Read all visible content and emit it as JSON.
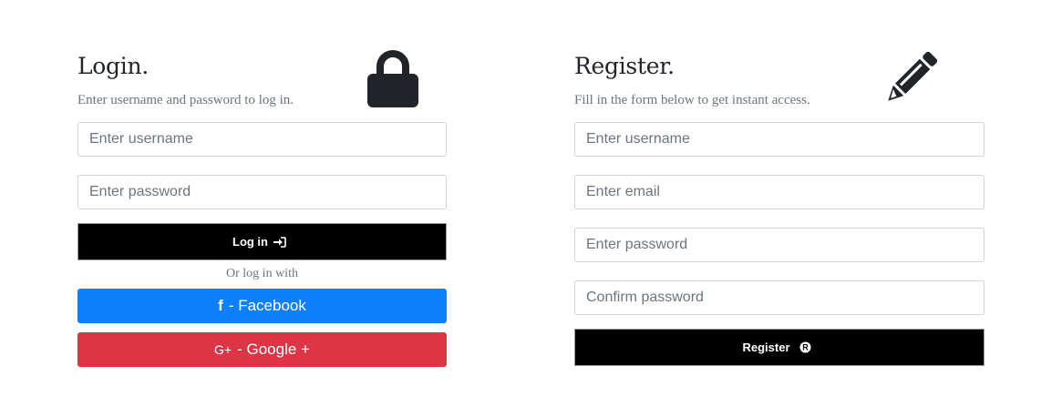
{
  "login": {
    "title": "Login.",
    "subtitle": "Enter username and password to log in.",
    "icon": "lock-icon",
    "username_placeholder": "Enter username",
    "password_placeholder": "Enter password",
    "submit_label": "Log in",
    "submit_icon": "sign-in-icon",
    "or_text": "Or log in with",
    "facebook_prefix": "f",
    "facebook_label": "- Facebook",
    "facebook_icon": "facebook-icon",
    "google_prefix": "G+",
    "google_label": "- Google +",
    "google_icon": "google-plus-icon"
  },
  "register": {
    "title": "Register.",
    "subtitle": "Fill in the form below to get instant access.",
    "icon": "pencil-icon",
    "username_placeholder": "Enter username",
    "email_placeholder": "Enter email",
    "password_placeholder": "Enter password",
    "confirm_placeholder": "Confirm password",
    "submit_label": "Register",
    "submit_icon": "registered-icon"
  },
  "colors": {
    "facebook": "#0d7ff8",
    "google": "#dc3545",
    "primary_button": "#000000",
    "icon": "#212529"
  }
}
